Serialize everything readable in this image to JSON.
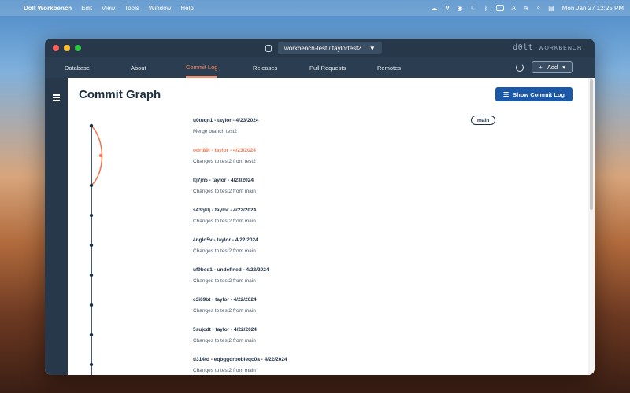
{
  "menubar": {
    "app_name": "Dolt Workbench",
    "items": [
      "Edit",
      "View",
      "Tools",
      "Window",
      "Help"
    ],
    "clock": "Mon Jan 27  12:25 PM"
  },
  "window": {
    "database_selector": "workbench-test / taylortest2",
    "brand_logo": "d0lt",
    "brand_sub": "WORKBENCH"
  },
  "nav": {
    "tabs": [
      {
        "label": "Database",
        "active": false
      },
      {
        "label": "About",
        "active": false
      },
      {
        "label": "Commit Log",
        "active": true
      },
      {
        "label": "Releases",
        "active": false
      },
      {
        "label": "Pull Requests",
        "active": false
      },
      {
        "label": "Remotes",
        "active": false
      }
    ],
    "add_label": "Add"
  },
  "page": {
    "title": "Commit Graph",
    "show_log_label": "Show Commit Log",
    "branch_tag": "main"
  },
  "commits": [
    {
      "head": "u0tuqn1 - taylor - 4/23/2024",
      "message": "Merge branch test2",
      "highlight": false
    },
    {
      "head": "odrt89l - taylor - 4/23/2024",
      "message": "Changes to test2 from test2",
      "highlight": true
    },
    {
      "head": "ltj7jn5 - taylor - 4/23/2024",
      "message": "Changes to test2 from main",
      "highlight": false
    },
    {
      "head": "s43qklj - taylor - 4/22/2024",
      "message": "Changes to test2 from main",
      "highlight": false
    },
    {
      "head": "4nglo5v - taylor - 4/22/2024",
      "message": "Changes to test2 from main",
      "highlight": false
    },
    {
      "head": "uf9bed1 - undefined - 4/22/2024",
      "message": "Changes to test2 from main",
      "highlight": false
    },
    {
      "head": "c3i69bt - taylor - 4/22/2024",
      "message": "Changes to test2 from main",
      "highlight": false
    },
    {
      "head": "5sujcdt - taylor - 4/22/2024",
      "message": "Changes to test2 from main",
      "highlight": false
    },
    {
      "head": "ti314td - eqbggdrbobieqc0a - 4/22/2024",
      "message": "Changes to test2 from main",
      "highlight": false
    }
  ],
  "colors": {
    "main_branch": "#1d2f45",
    "side_branch": "#f07851",
    "accent_button": "#1b58a8"
  }
}
